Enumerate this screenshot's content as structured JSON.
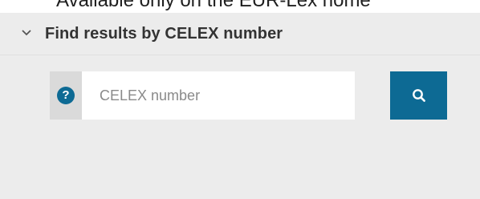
{
  "page": {
    "clipped_heading": "Available only on the EUR-Lex home"
  },
  "panel": {
    "title": "Find results by CELEX number",
    "chevron_icon": "chevron-down-icon"
  },
  "search": {
    "help_label": "?",
    "help_icon": "help-icon",
    "placeholder": "CELEX number",
    "value": "",
    "button_icon": "search-icon"
  },
  "colors": {
    "accent": "#0d6a94",
    "panel_bg": "#ececec",
    "addon_bg": "#dadada",
    "input_bg": "#ffffff"
  }
}
